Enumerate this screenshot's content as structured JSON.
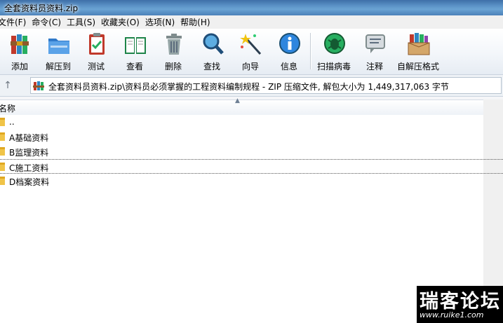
{
  "window": {
    "title": "全套资料员资料.zip"
  },
  "menu": [
    "文件(F)",
    "命令(C)",
    "工具(S)",
    "收藏夹(O)",
    "选项(N)",
    "帮助(H)"
  ],
  "toolbar": {
    "add": "添加",
    "extract": "解压到",
    "test": "测试",
    "view": "查看",
    "delete": "删除",
    "find": "查找",
    "wizard": "向导",
    "info": "信息",
    "scan": "扫描病毒",
    "comment": "注释",
    "sfx": "自解压格式"
  },
  "address": {
    "path": "全套资料员资料.zip\\资料员必须掌握的工程资料编制规程 - ZIP 压缩文件, 解包大小为 1,449,317,063 字节"
  },
  "header": {
    "name": "名称"
  },
  "files": [
    "..",
    "A基础资料",
    "B监理资料",
    "C施工资料",
    "D档案资料"
  ],
  "watermark": {
    "title": "瑞客论坛",
    "url": "www.ruike1.com"
  },
  "colors": {
    "folder": "#f0c448",
    "titlebar": "#5d94c8"
  }
}
